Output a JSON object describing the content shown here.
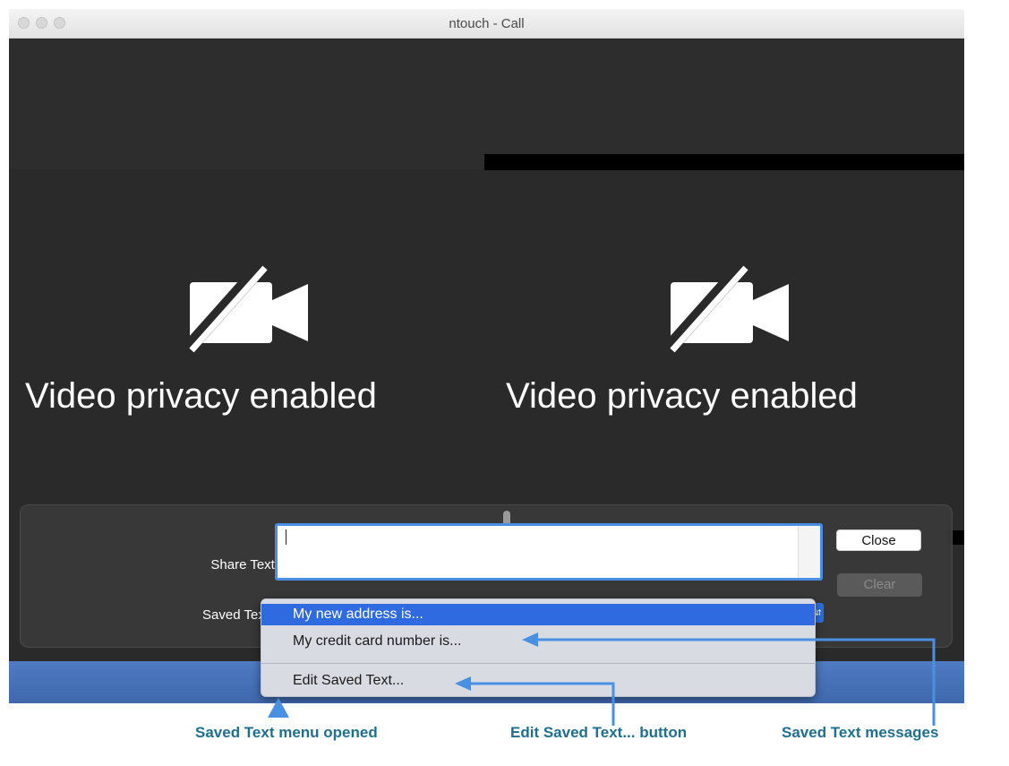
{
  "window": {
    "title": "ntouch - Call"
  },
  "video": {
    "left_pane_label": "Video privacy enabled",
    "right_pane_label": "Video privacy enabled",
    "icon": "video-camera-off-icon"
  },
  "share_panel": {
    "share_text_label": "Share Text:",
    "share_text_value": "",
    "close_label": "Close",
    "clear_label": "Clear",
    "saved_text_label": "Saved Text"
  },
  "saved_text_menu": {
    "items": [
      {
        "label": "My new address is...",
        "selected": true
      },
      {
        "label": "My credit card number is..."
      }
    ],
    "edit_label": "Edit Saved Text..."
  },
  "callouts": {
    "menu_opened": "Saved Text menu opened",
    "edit_button": "Edit Saved Text... button",
    "messages": "Saved Text messages"
  },
  "colors": {
    "callout_text": "#1f6f8e",
    "arrow": "#4a90e2",
    "menu_highlight": "#2f6ae0"
  }
}
